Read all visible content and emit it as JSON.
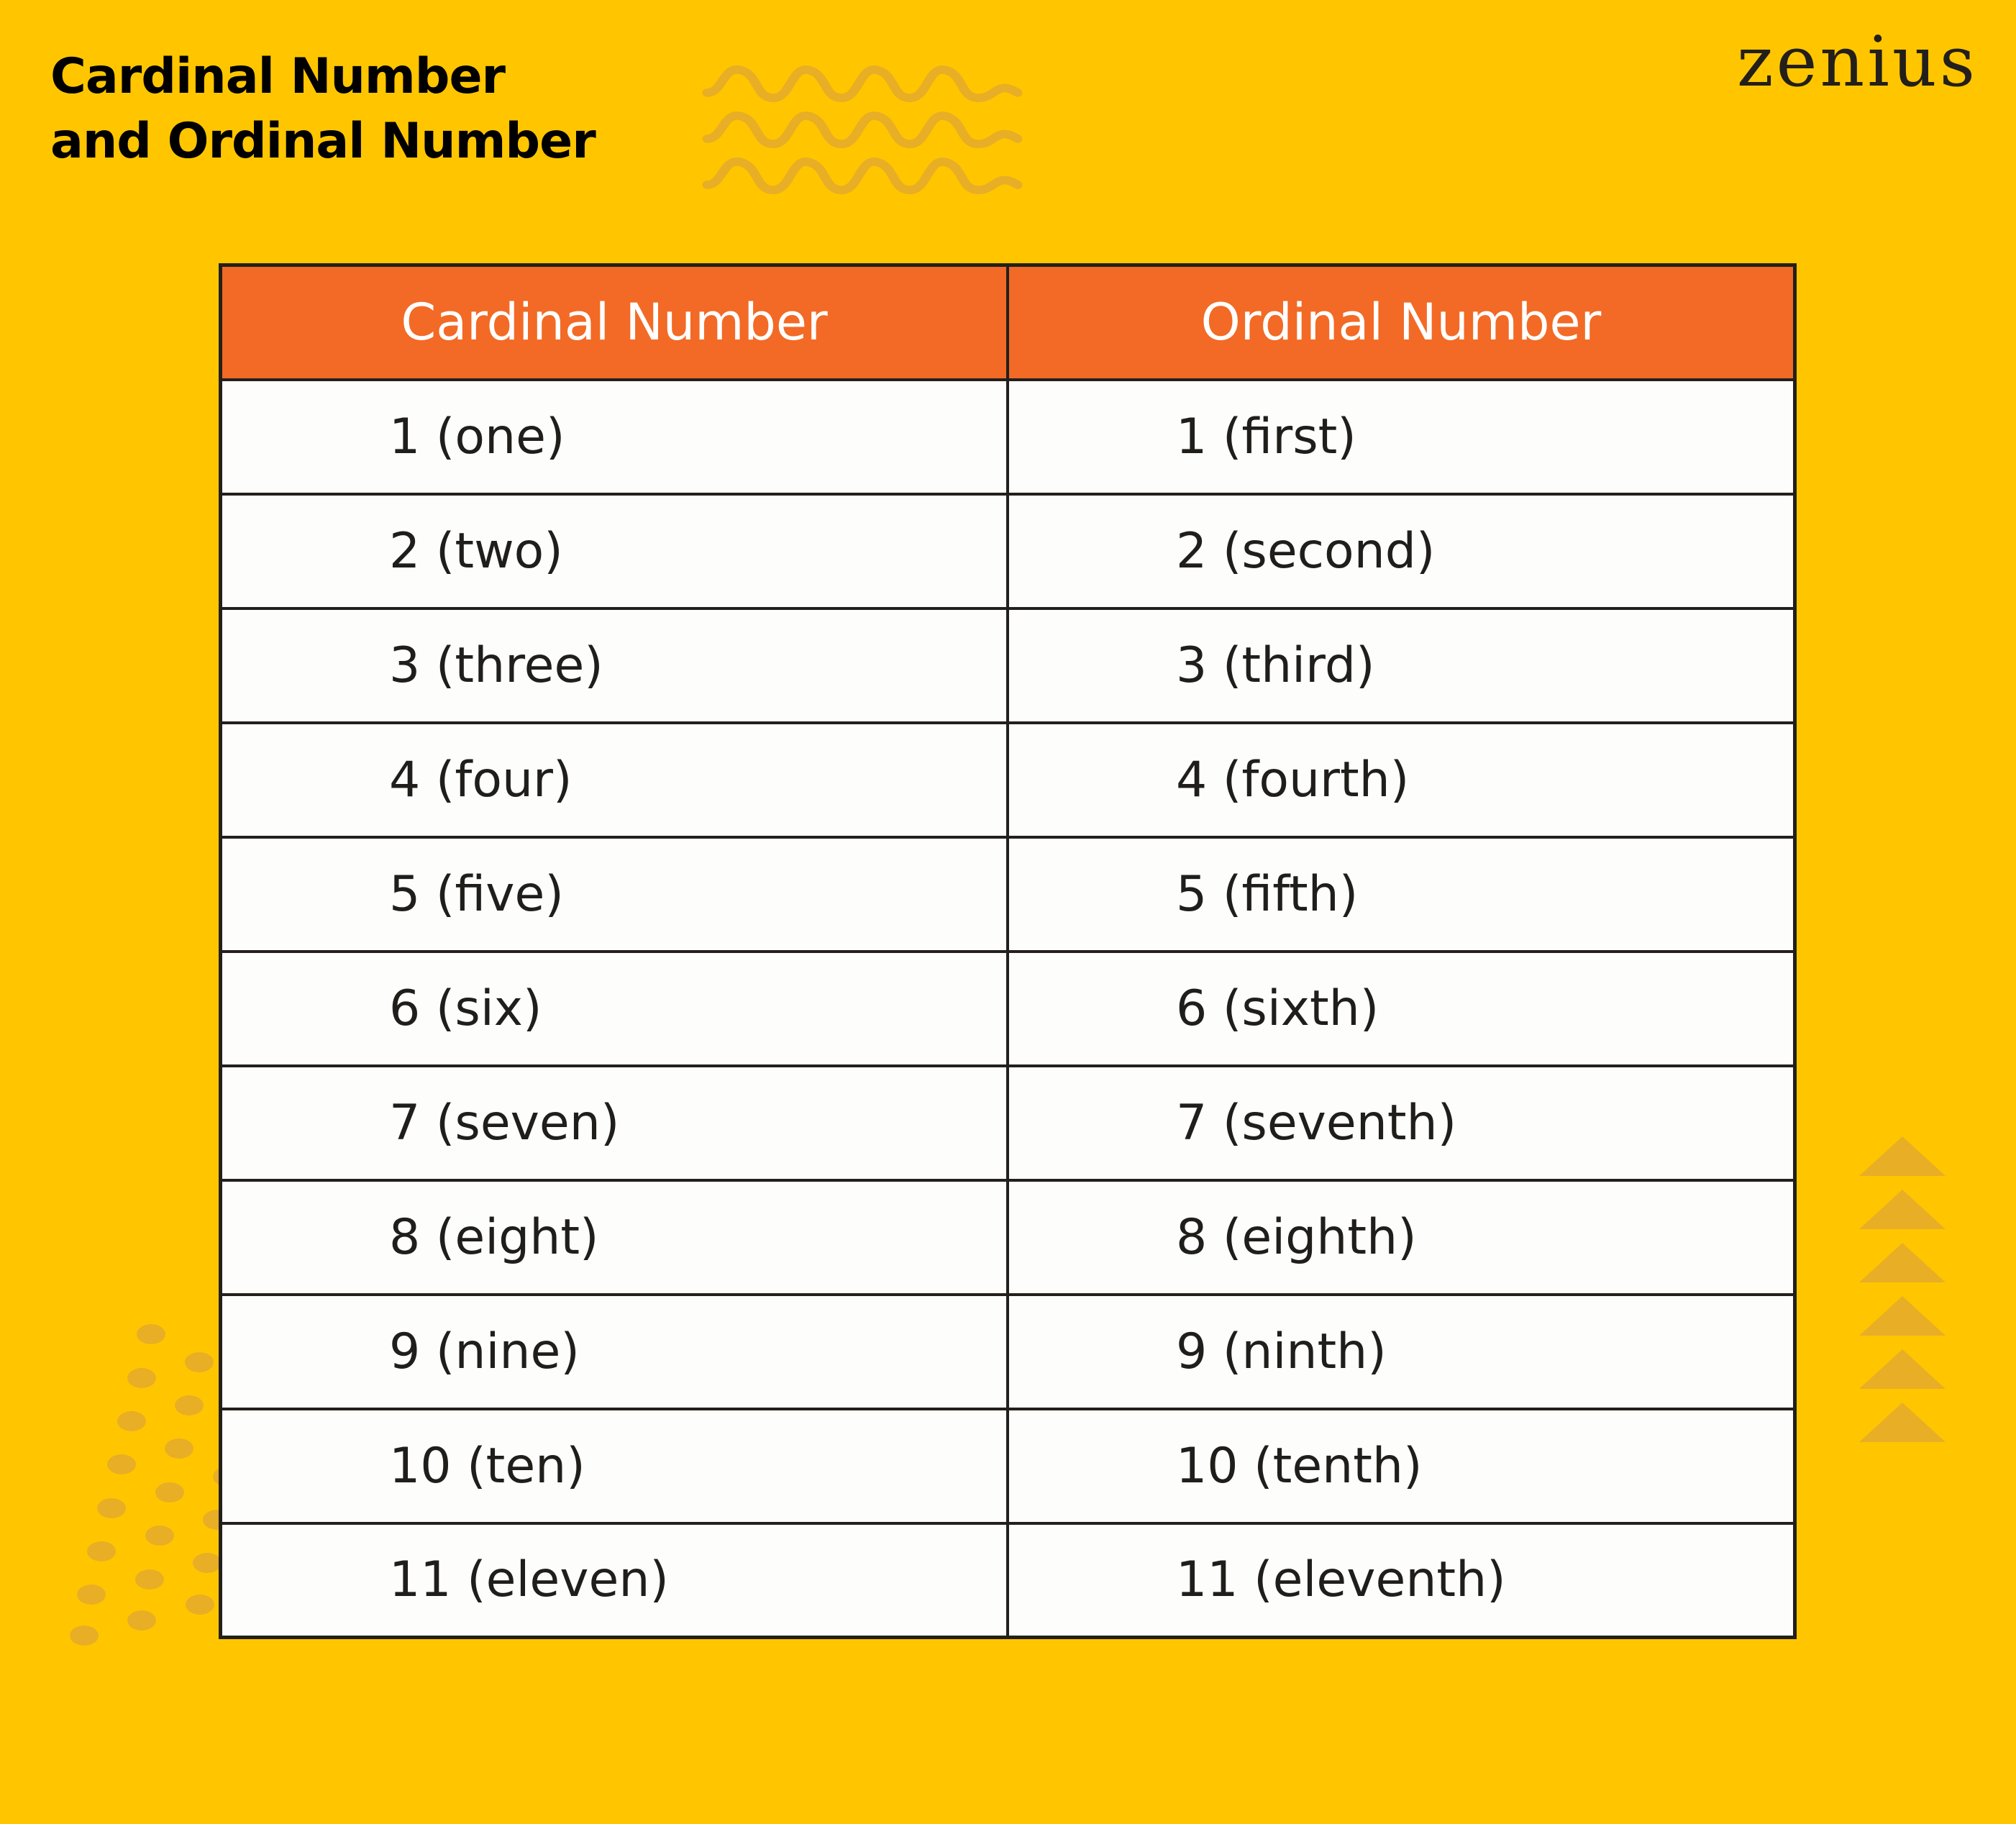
{
  "title": {
    "line1": "Cardinal Number",
    "line2": "and Ordinal Number"
  },
  "brand": {
    "logo_text": "zenius"
  },
  "colors": {
    "background": "#FFC600",
    "header": "#F26A25",
    "decor": "#E8AE26",
    "text": "#1F1E1B"
  },
  "table": {
    "headers": [
      "Cardinal Number",
      "Ordinal Number"
    ],
    "rows": [
      [
        "1 (one)",
        "1 (first)"
      ],
      [
        "2 (two)",
        "2 (second)"
      ],
      [
        "3 (three)",
        "3 (third)"
      ],
      [
        "4 (four)",
        "4 (fourth)"
      ],
      [
        "5 (five)",
        "5 (fifth)"
      ],
      [
        "6 (six)",
        "6 (sixth)"
      ],
      [
        "7 (seven)",
        "7 (seventh)"
      ],
      [
        "8 (eight)",
        "8 (eighth)"
      ],
      [
        "9 (nine)",
        "9 (ninth)"
      ],
      [
        "10 (ten)",
        "10 (tenth)"
      ],
      [
        "11 (eleven)",
        "11 (eleventh)"
      ]
    ]
  },
  "decorations": {
    "waves": "wave-decoration",
    "dots": "dot-pattern-decoration",
    "triangles": "triangle-decoration"
  }
}
